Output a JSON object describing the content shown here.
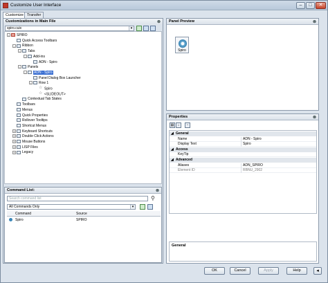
{
  "window": {
    "title": "Customize User Interface"
  },
  "tabs": [
    "Customize",
    "Transfer"
  ],
  "customizations": {
    "header": "Customizations in Main File",
    "file_value": "spiro.cuix",
    "tree": [
      {
        "label": "SPIRO",
        "indent": 0,
        "exp": "-",
        "icon": "red"
      },
      {
        "label": "Quick Access Toolbars",
        "indent": 1,
        "exp": "",
        "icon": "box"
      },
      {
        "label": "Ribbon",
        "indent": 1,
        "exp": "-",
        "icon": "box"
      },
      {
        "label": "Tabs",
        "indent": 2,
        "exp": "-",
        "icon": "box"
      },
      {
        "label": "Add-ins",
        "indent": 3,
        "exp": "-",
        "icon": "box"
      },
      {
        "label": "ADN - Spiro",
        "indent": 4,
        "exp": "",
        "icon": "box"
      },
      {
        "label": "Panels",
        "indent": 2,
        "exp": "-",
        "icon": "box"
      },
      {
        "label": "ADN - Spiro",
        "indent": 3,
        "exp": "-",
        "icon": "box",
        "selected": true
      },
      {
        "label": "Panel Dialog Box Launcher",
        "indent": 4,
        "exp": "",
        "icon": "box"
      },
      {
        "label": "Row 1",
        "indent": 4,
        "exp": "-",
        "icon": "box"
      },
      {
        "label": "Spiro",
        "indent": 5,
        "exp": "",
        "icon": "star"
      },
      {
        "label": "<SLIDEOUT>",
        "indent": 5,
        "exp": "",
        "icon": "star"
      },
      {
        "label": "Contextual Tab States",
        "indent": 2,
        "exp": "",
        "icon": "box"
      },
      {
        "label": "Toolbars",
        "indent": 1,
        "exp": "",
        "icon": "box"
      },
      {
        "label": "Menus",
        "indent": 1,
        "exp": "",
        "icon": "box"
      },
      {
        "label": "Quick Properties",
        "indent": 1,
        "exp": "",
        "icon": "box"
      },
      {
        "label": "Rollover Tooltips",
        "indent": 1,
        "exp": "",
        "icon": "box"
      },
      {
        "label": "Shortcut Menus",
        "indent": 1,
        "exp": "",
        "icon": "box"
      },
      {
        "label": "Keyboard Shortcuts",
        "indent": 1,
        "exp": "+",
        "icon": "box"
      },
      {
        "label": "Double Click Actions",
        "indent": 1,
        "exp": "+",
        "icon": "box"
      },
      {
        "label": "Mouse Buttons",
        "indent": 1,
        "exp": "+",
        "icon": "box"
      },
      {
        "label": "LISP Files",
        "indent": 1,
        "exp": "+",
        "icon": "box"
      },
      {
        "label": "Legacy",
        "indent": 1,
        "exp": "+",
        "icon": "box"
      }
    ]
  },
  "command_list": {
    "header": "Command List:",
    "search_placeholder": "Search command list",
    "filter_value": "All Commands Only",
    "columns": [
      "Command",
      "Source"
    ],
    "rows": [
      {
        "command": "Spiro",
        "source": "SPIRO"
      }
    ]
  },
  "panel_preview": {
    "header": "Panel Preview",
    "tile_label": "Spiro"
  },
  "properties": {
    "header": "Properties",
    "categories": [
      {
        "name": "General",
        "rows": [
          {
            "name": "Name",
            "value": "ADN - Spiro",
            "readonly": false
          },
          {
            "name": "Display Text",
            "value": "Spiro",
            "readonly": false
          }
        ]
      },
      {
        "name": "Access",
        "rows": [
          {
            "name": "KeyTip",
            "value": "",
            "readonly": false
          }
        ]
      },
      {
        "name": "Advanced",
        "rows": [
          {
            "name": "Aliases",
            "value": "ADN_SPIRO",
            "readonly": false
          },
          {
            "name": "Element ID",
            "value": "RBNU_2902",
            "readonly": true
          }
        ]
      }
    ],
    "description_title": "General"
  },
  "buttons": {
    "ok": "OK",
    "cancel": "Cancel",
    "apply": "Apply",
    "help": "Help"
  }
}
